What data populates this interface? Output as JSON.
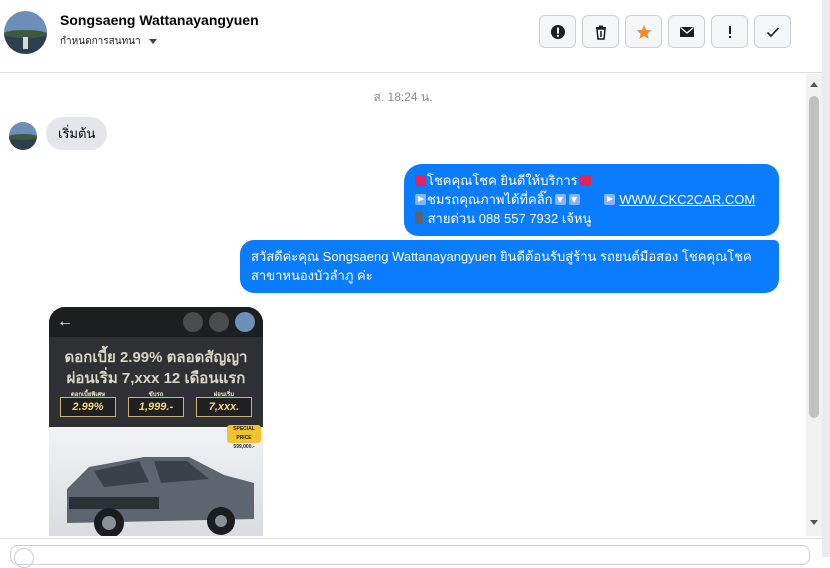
{
  "header": {
    "contact_name": "Songsaeng Wattanayangyuen",
    "assign_label": "กำหนดการสนทนา",
    "actions": [
      {
        "icon": "alert-circle-icon",
        "label": "!"
      },
      {
        "icon": "trash-icon",
        "label": ""
      },
      {
        "icon": "star-icon",
        "label": ""
      },
      {
        "icon": "envelope-icon",
        "label": ""
      },
      {
        "icon": "exclamation-icon",
        "label": "!"
      },
      {
        "icon": "check-icon",
        "label": ""
      }
    ]
  },
  "thread": {
    "timestamp": "ส. 18:24 น.",
    "incoming_start": "เริ่มต้น",
    "outgoing_1": {
      "line1": "โชคคุณโชค ยินดีให้บริการ",
      "line2": "ชมรถคุณภาพได้ที่คลิ๊ก",
      "link": "WWW.CKC2CAR.COM",
      "line3": "สายด่วน 088 557 7932 เจ้หนู"
    },
    "outgoing_2": "สวัสดีค่ะคุณ Songsaeng Wattanayangyuen ยินดีต้อนรับสู่ร้าน รถยนต์มือสอง โชคคุณโชค สาขาหนองบัวลำภู ค่ะ",
    "image_card": {
      "promo_line1": "ดอกเบี้ย 2.99% ตลอดสัญญา",
      "promo_line2": "ผ่อนเริ่ม 7,xxx 12 เดือนแรก",
      "box1_caption": "ดอกเบี้ยพิเศษ",
      "box1_value": "2.99%",
      "box2_caption": "ขับรถ",
      "box2_value": "1,999.-",
      "box3_caption": "ผ่อนเริ่ม",
      "box3_value": "7,xxx.",
      "badge_line1": "SPECIAL PRICE",
      "badge_line2": "599,000.-"
    }
  },
  "colors": {
    "outgoing_bubble": "#0a7cff",
    "incoming_bubble": "#e4e6eb",
    "star": "#f28c28"
  }
}
